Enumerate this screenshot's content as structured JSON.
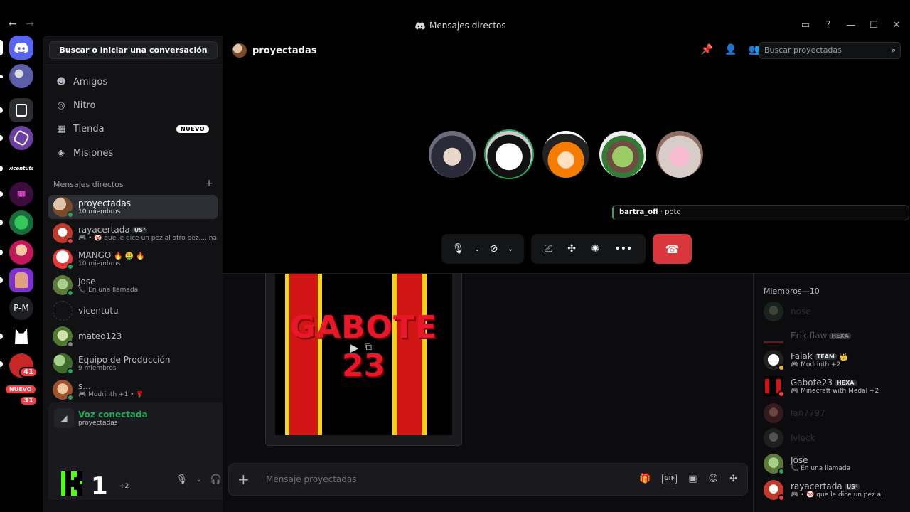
{
  "window": {
    "title": "Mensajes directos",
    "nav_back": "←",
    "nav_forward": "→",
    "controls": [
      "▭",
      "?",
      "—",
      "☐",
      "✕"
    ]
  },
  "rail": {
    "server_text_pm": "P-M",
    "badge_1": "41",
    "nuevo": "NUEVO",
    "badge_2": "31"
  },
  "sidebar": {
    "search_label": "Buscar o iniciar una conversación",
    "nav": [
      {
        "label": "Amigos",
        "icon": "friends-icon"
      },
      {
        "label": "Nitro",
        "icon": "nitro-icon"
      },
      {
        "label": "Tienda",
        "icon": "shop-icon",
        "badge": "NUEVO"
      },
      {
        "label": "Misiones",
        "icon": "quests-icon"
      }
    ],
    "dm_header": "Mensajes directos",
    "dm_add": "+",
    "dms": [
      {
        "name": "proyectadas",
        "sub": "10 miembros"
      },
      {
        "name": "rayacertada",
        "tag": "US²",
        "sub": "🎮 • 🤡 que le dice un pez al otro pez.... na..."
      },
      {
        "name": "MANGO",
        "emoji": "🔥 🤑 🔥",
        "sub": "10 miembros"
      },
      {
        "name": "Jose",
        "sub": "📞 En una llamada"
      },
      {
        "name": "vicentutu",
        "sub": ""
      },
      {
        "name": "mateo123",
        "sub": ""
      },
      {
        "name": "Equipo de Producción",
        "sub": "9 miembros"
      },
      {
        "name": "s...",
        "sub": "🎮 Modrinth +1 • 🌹"
      }
    ]
  },
  "voice": {
    "status": "Voz conectada",
    "channel": "proyectadas"
  },
  "user": {
    "extra": "+2"
  },
  "header": {
    "channel": "proyectadas",
    "search_placeholder": "Buscar proyectadas"
  },
  "call": {
    "toast_user": "bartra_ofi",
    "toast_sep": "·",
    "toast_msg": "poto"
  },
  "embed": {
    "title_line1": "GABOTE",
    "title_line2": "23"
  },
  "composer": {
    "placeholder": "Mensaje proyectadas",
    "plus": "+"
  },
  "members": {
    "header": "Miembros—10",
    "list": [
      {
        "name": "nose",
        "offline": true,
        "sub": ""
      },
      {
        "name": "Erik flaw",
        "tag": "HEXA",
        "offline": true,
        "sub": ""
      },
      {
        "name": "Falak",
        "tag": "TEAM",
        "crown": "👑",
        "sub": "🎮 Modrinth +2"
      },
      {
        "name": "Gabote23",
        "tag": "HEXA",
        "sub": "🎮 Minecraft with Medal +2"
      },
      {
        "name": "lan7797",
        "offline": true,
        "sub": ""
      },
      {
        "name": "lvlock",
        "offline": true,
        "sub": ""
      },
      {
        "name": "Jose",
        "sub": "📞 En una llamada"
      },
      {
        "name": "rayacertada",
        "tag": "US²",
        "sub": "🎮 • 🤡 que le dice un pez al o..."
      }
    ]
  },
  "colors": {
    "online": "#23a55a",
    "dnd": "#f23f43",
    "hangup": "#da373c",
    "accent": "#5865f2"
  }
}
